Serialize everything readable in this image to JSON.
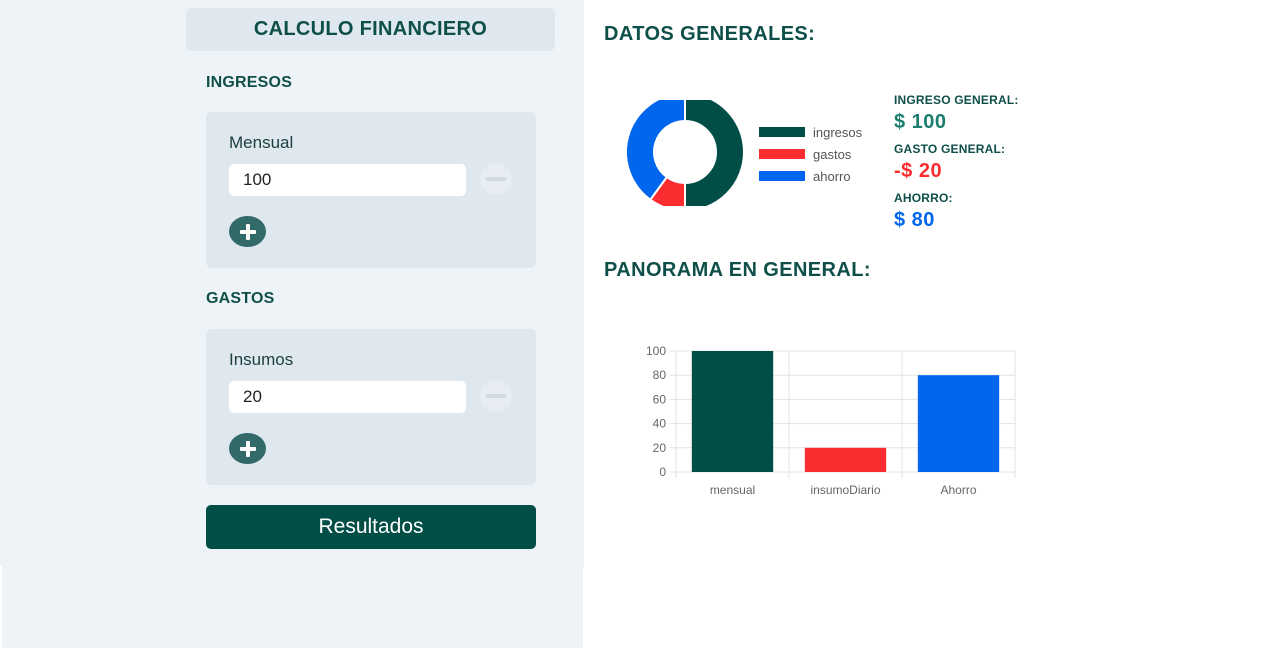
{
  "app": {
    "title": "CALCULO FINANCIERO"
  },
  "ingresos": {
    "section_label": "INGRESOS",
    "items": [
      {
        "label": "Mensual",
        "value": "100"
      }
    ]
  },
  "gastos": {
    "section_label": "GASTOS",
    "items": [
      {
        "label": "Insumos",
        "value": "20"
      }
    ]
  },
  "results_button": "Resultados",
  "general": {
    "heading": "DATOS GENERALES:",
    "ingreso_label": "INGRESO GENERAL:",
    "ingreso_value": "$ 100",
    "gasto_label": "GASTO GENERAL:",
    "gasto_value": "-$ 20",
    "ahorro_label": "AHORRO:",
    "ahorro_value": "$ 80"
  },
  "panorama": {
    "heading": "PANORAMA EN GENERAL:"
  },
  "colors": {
    "primary": "#014e47",
    "ingresos": "#014e47",
    "gastos": "#fb2d31",
    "ahorro": "#0066ee",
    "ingreso_value": "#1b7e6e",
    "gasto_value": "#fb2d31",
    "ahorro_value": "#0066ee"
  },
  "chart_data": [
    {
      "type": "pie",
      "labels": [
        "ingresos",
        "gastos",
        "ahorro"
      ],
      "values": [
        100,
        20,
        80
      ],
      "colors": [
        "#014e47",
        "#fb2d31",
        "#0066ee"
      ],
      "legend": "right"
    },
    {
      "type": "bar",
      "categories": [
        "mensual",
        "insumoDiario",
        "Ahorro"
      ],
      "values": [
        100,
        20,
        80
      ],
      "colors": [
        "#014e47",
        "#fb2d31",
        "#0066ee"
      ],
      "ylim": [
        0,
        100
      ],
      "yticks": [
        "0",
        "20",
        "40",
        "60",
        "80",
        "100"
      ],
      "grid": true
    }
  ]
}
